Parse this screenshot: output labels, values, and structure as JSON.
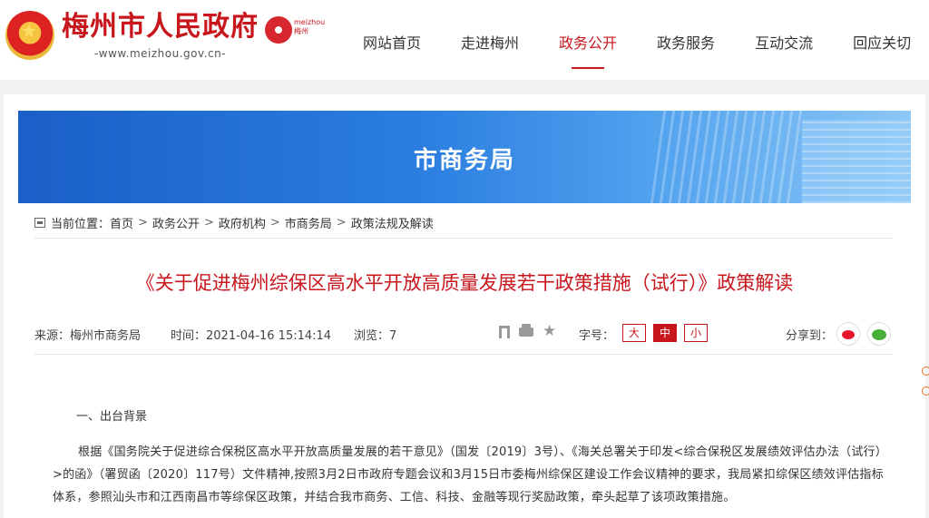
{
  "site": {
    "title": "梅州市人民政府",
    "url": "-www.meizhou.gov.cn-",
    "badge_en": "meizhou",
    "badge_cn": "梅州"
  },
  "nav": {
    "items": [
      "网站首页",
      "走进梅州",
      "政务公开",
      "政务服务",
      "互动交流",
      "回应关切"
    ],
    "active_index": 2
  },
  "banner": {
    "title": "市商务局"
  },
  "breadcrumb": {
    "prefix": "当前位置：",
    "items": [
      "首页",
      "政务公开",
      "政府机构",
      "市商务局",
      "政策法规及解读"
    ],
    "separator": ">"
  },
  "article": {
    "title": "《关于促进梅州综保区高水平开放高质量发展若干政策措施（试行）》政策解读",
    "source": "来源：梅州市商务局",
    "time": "时间：2021-04-16 15:14:14",
    "views": "浏览：7",
    "font_label": "字号：",
    "font_sizes": [
      "大",
      "中",
      "小"
    ],
    "font_active": 1,
    "share_label": "分享到：",
    "section1": "一、出台背景",
    "paragraph1": "根据《国务院关于促进综合保税区高水平开放高质量发展的若干意见》（国发〔2019〕3号）、《海关总署关于印发<综合保税区发展绩效评估办法（试行）>的函》（署贸函〔2020〕117号）文件精神,按照3月2日市政府专题会议和3月15日市委梅州综保区建设工作会议精神的要求，我局紧扣综保区绩效评估指标体系，参照汕头市和江西南昌市等综保区政策，并结合我市商务、工信、科技、金融等现行奖励政策，牵头起草了该项政策措施。"
  },
  "colors": {
    "brand_red": "#c8161d",
    "banner_blue": "#1a5fc7"
  }
}
